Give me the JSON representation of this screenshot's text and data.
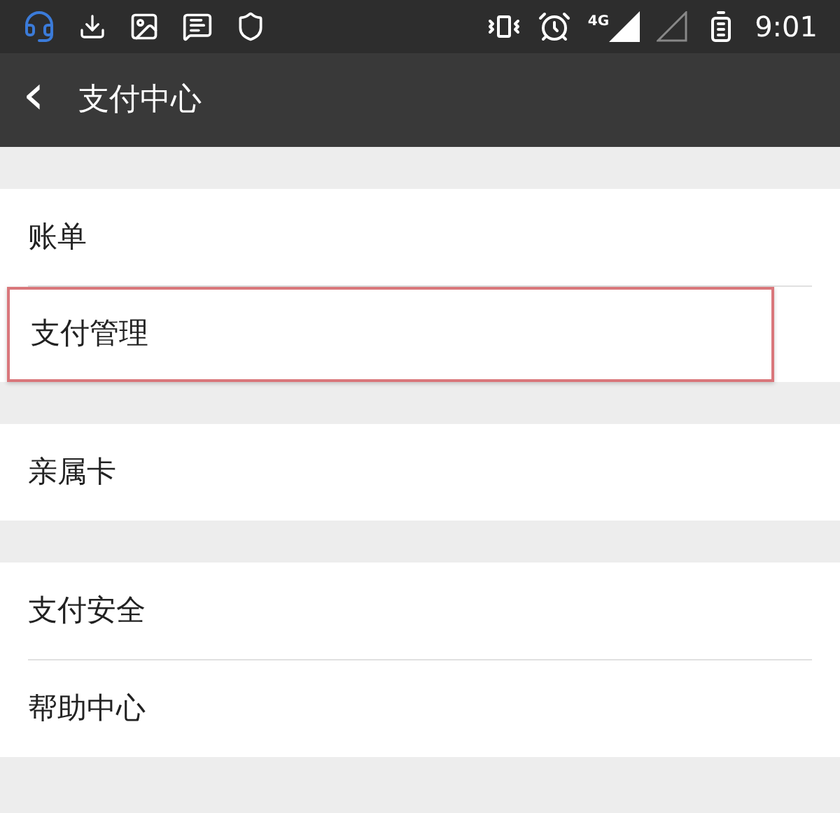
{
  "status_bar": {
    "network": "4G",
    "time": "9:01"
  },
  "toolbar": {
    "back": "‹",
    "title": "支付中心"
  },
  "groups": [
    {
      "items": [
        {
          "label": "账单",
          "highlighted": false
        },
        {
          "label": "支付管理",
          "highlighted": true
        }
      ]
    },
    {
      "items": [
        {
          "label": "亲属卡",
          "highlighted": false
        }
      ]
    },
    {
      "items": [
        {
          "label": "支付安全",
          "highlighted": false
        },
        {
          "label": "帮助中心",
          "highlighted": false
        }
      ]
    }
  ]
}
